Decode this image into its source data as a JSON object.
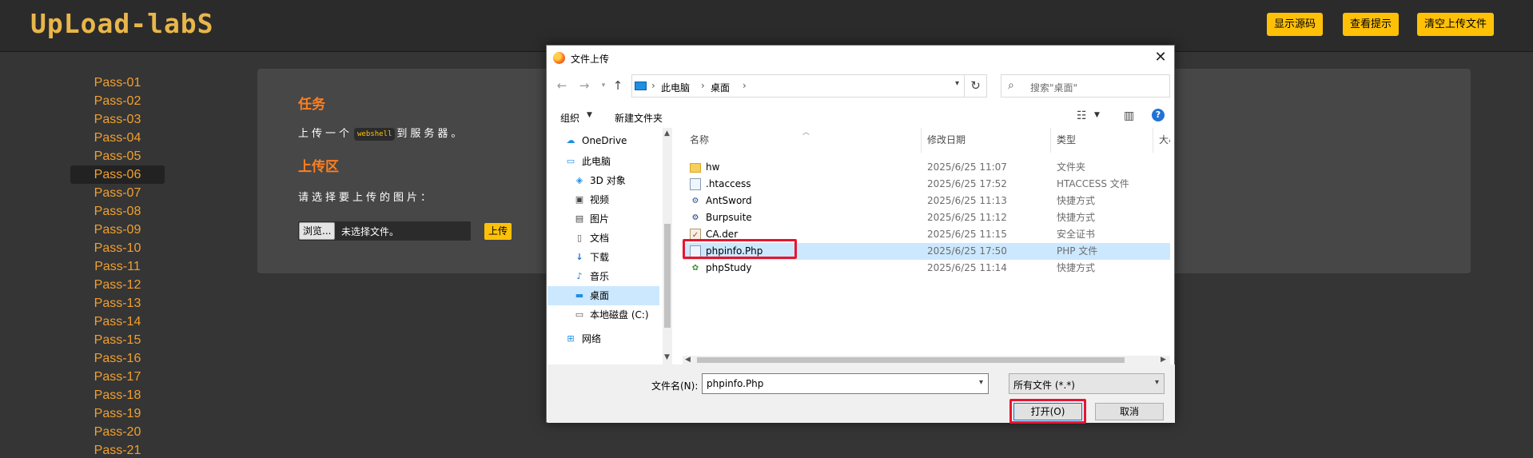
{
  "header": {
    "logo_text": "UpLoad-labS",
    "buttons": [
      "显示源码",
      "查看提示",
      "清空上传文件"
    ],
    "accent_color": "#ffc107"
  },
  "menu": {
    "active": "Pass-06",
    "items": [
      "Pass-01",
      "Pass-02",
      "Pass-03",
      "Pass-04",
      "Pass-05",
      "Pass-06",
      "Pass-07",
      "Pass-08",
      "Pass-09",
      "Pass-10",
      "Pass-11",
      "Pass-12",
      "Pass-13",
      "Pass-14",
      "Pass-15",
      "Pass-16",
      "Pass-17",
      "Pass-18",
      "Pass-19",
      "Pass-20",
      "Pass-21"
    ]
  },
  "task": {
    "task_heading": "任务",
    "task_text_before": "上传一个",
    "task_code": "webshell",
    "task_text_after": "到服务器。",
    "upload_heading": "上传区",
    "select_prompt": "请选择要上传的图片：",
    "browse_label": "浏览...",
    "no_file_label": "未选择文件。",
    "upload_button": "上传"
  },
  "dialog": {
    "title": "文件上传",
    "close_glyph": "✕",
    "breadcrumb": [
      "此电脑",
      "桌面"
    ],
    "search_placeholder": "搜索\"桌面\"",
    "toolbar": {
      "organize": "组织",
      "new_folder": "新建文件夹"
    },
    "nav_items": [
      {
        "label": "OneDrive",
        "icon": "cloud-icon",
        "selected": false
      },
      {
        "label": "此电脑",
        "icon": "pc-icon",
        "selected": false
      },
      {
        "label": "3D 对象",
        "icon": "cube-icon",
        "selected": false
      },
      {
        "label": "视频",
        "icon": "video-icon",
        "selected": false
      },
      {
        "label": "图片",
        "icon": "picture-icon",
        "selected": false
      },
      {
        "label": "文档",
        "icon": "document-icon",
        "selected": false
      },
      {
        "label": "下载",
        "icon": "download-icon",
        "selected": false
      },
      {
        "label": "音乐",
        "icon": "music-icon",
        "selected": false
      },
      {
        "label": "桌面",
        "icon": "desktop-icon",
        "selected": true
      },
      {
        "label": "本地磁盘 (C:)",
        "icon": "disk-icon",
        "selected": false
      },
      {
        "label": "网络",
        "icon": "network-icon",
        "selected": false
      }
    ],
    "columns": {
      "name": "名称",
      "date": "修改日期",
      "type": "类型",
      "size": "大小"
    },
    "files": [
      {
        "name": "hw",
        "date": "2025/6/25 11:07",
        "type": "文件夹",
        "icon": "folder-icon",
        "selected": false
      },
      {
        "name": ".htaccess",
        "date": "2025/6/25 17:52",
        "type": "HTACCESS 文件",
        "icon": "file-icon",
        "selected": false
      },
      {
        "name": "AntSword",
        "date": "2025/6/25 11:13",
        "type": "快捷方式",
        "icon": "shortcut-icon",
        "selected": false
      },
      {
        "name": "Burpsuite",
        "date": "2025/6/25 11:12",
        "type": "快捷方式",
        "icon": "shortcut-icon",
        "selected": false
      },
      {
        "name": "CA.der",
        "date": "2025/6/25 11:15",
        "type": "安全证书",
        "icon": "certificate-icon",
        "selected": false
      },
      {
        "name": "phpinfo.Php",
        "date": "2025/6/25 17:50",
        "type": "PHP 文件",
        "icon": "file-icon",
        "selected": true
      },
      {
        "name": "phpStudy",
        "date": "2025/6/25 11:14",
        "type": "快捷方式",
        "icon": "shortcut-icon",
        "selected": false
      }
    ],
    "filename_label": "文件名(N):",
    "filename_value": "phpinfo.Php",
    "filter_value": "所有文件 (*.*)",
    "open_button": "打开(O)",
    "cancel_button": "取消",
    "highlight_color": "#e8152f",
    "selection_color": "#cce8ff"
  }
}
